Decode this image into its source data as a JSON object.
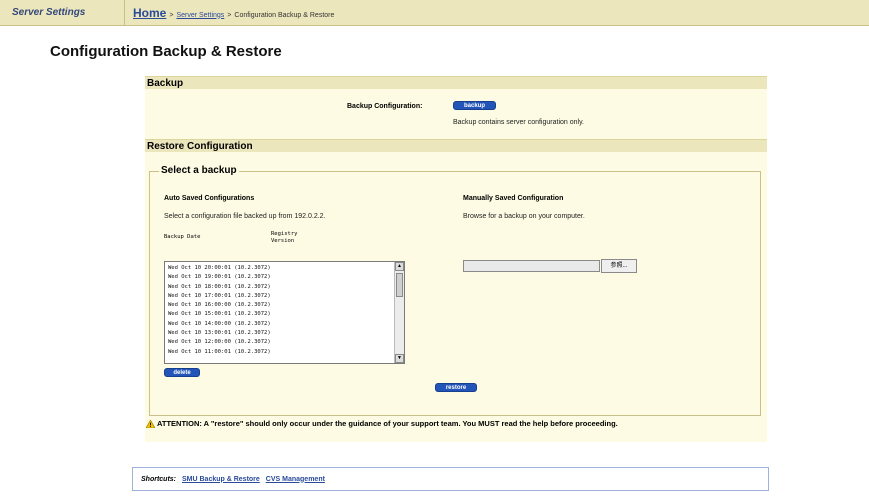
{
  "topbar": {
    "section": "Server Settings",
    "breadcrumb": {
      "home": "Home",
      "sep1": ">",
      "server_settings": "Server Settings",
      "sep2": ">",
      "current": "Configuration Backup & Restore"
    }
  },
  "page_title": "Configuration Backup & Restore",
  "backup": {
    "heading": "Backup",
    "label": "Backup Configuration:",
    "button": "backup",
    "note": "Backup contains server configuration only."
  },
  "restore": {
    "heading": "Restore Configuration",
    "legend": "Select a backup",
    "auto": {
      "title": "Auto Saved Configurations",
      "description": "Select a configuration file backed up from 192.0.2.2.",
      "col_date": "Backup Date",
      "col_version_1": "Registry",
      "col_version_2": "Version",
      "entries": [
        "Wed Oct 10 20:00:01 (10.2.3072)",
        "Wed Oct 10 19:00:01 (10.2.3072)",
        "Wed Oct 10 18:00:01 (10.2.3072)",
        "Wed Oct 10 17:00:01 (10.2.3072)",
        "Wed Oct 10 16:00:00 (10.2.3072)",
        "Wed Oct 10 15:00:01 (10.2.3072)",
        "Wed Oct 10 14:00:00 (10.2.3072)",
        "Wed Oct 10 13:00:01 (10.2.3072)",
        "Wed Oct 10 12:00:00 (10.2.3072)",
        "Wed Oct 10 11:00:01 (10.2.3072)"
      ],
      "delete_button": "delete"
    },
    "manual": {
      "title": "Manually Saved Configuration",
      "description": "Browse for a backup on your computer.",
      "file_value": "",
      "browse_button": "参照..."
    },
    "restore_button": "restore"
  },
  "attention": "ATTENTION: A \"restore\" should only occur under the guidance of your support team. You MUST read the help before proceeding.",
  "shortcuts": {
    "label": "Shortcuts:",
    "links": [
      "SMU Backup & Restore",
      "CVS Management"
    ]
  },
  "colors": {
    "header_bg": "#ece6bd",
    "panel_bg": "#fdfbe3",
    "button_blue": "#2355b8",
    "link_blue": "#2a4a9a"
  }
}
